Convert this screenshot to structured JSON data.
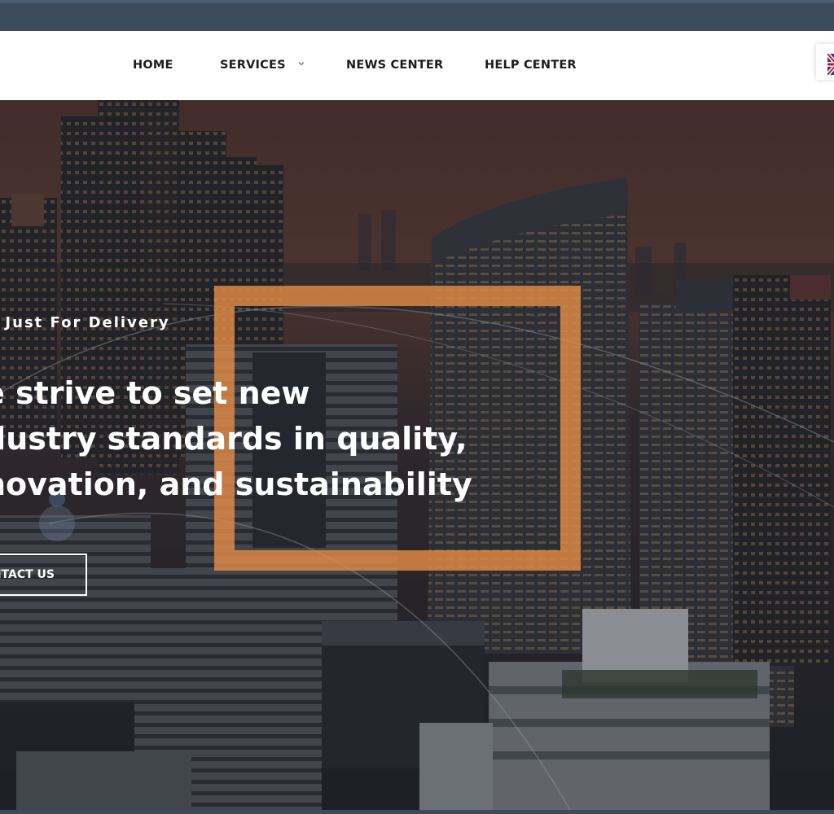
{
  "nav": {
    "items": [
      {
        "label": "HOME"
      },
      {
        "label": "SERVICES"
      },
      {
        "label": "NEWS CENTER"
      },
      {
        "label": "HELP CENTER"
      }
    ]
  },
  "language": {
    "icon": "uk-flag-icon"
  },
  "hero": {
    "tagline": "l Just For Delivery",
    "headline": [
      "e strive to set new",
      "dustry standards in quality,",
      "novation, and sustainability"
    ],
    "cta_label": "NTACT US"
  },
  "colors": {
    "topbar": "#3d4a5c",
    "accent_frame": "#e28b46",
    "nav_text": "#1d1d1d"
  }
}
